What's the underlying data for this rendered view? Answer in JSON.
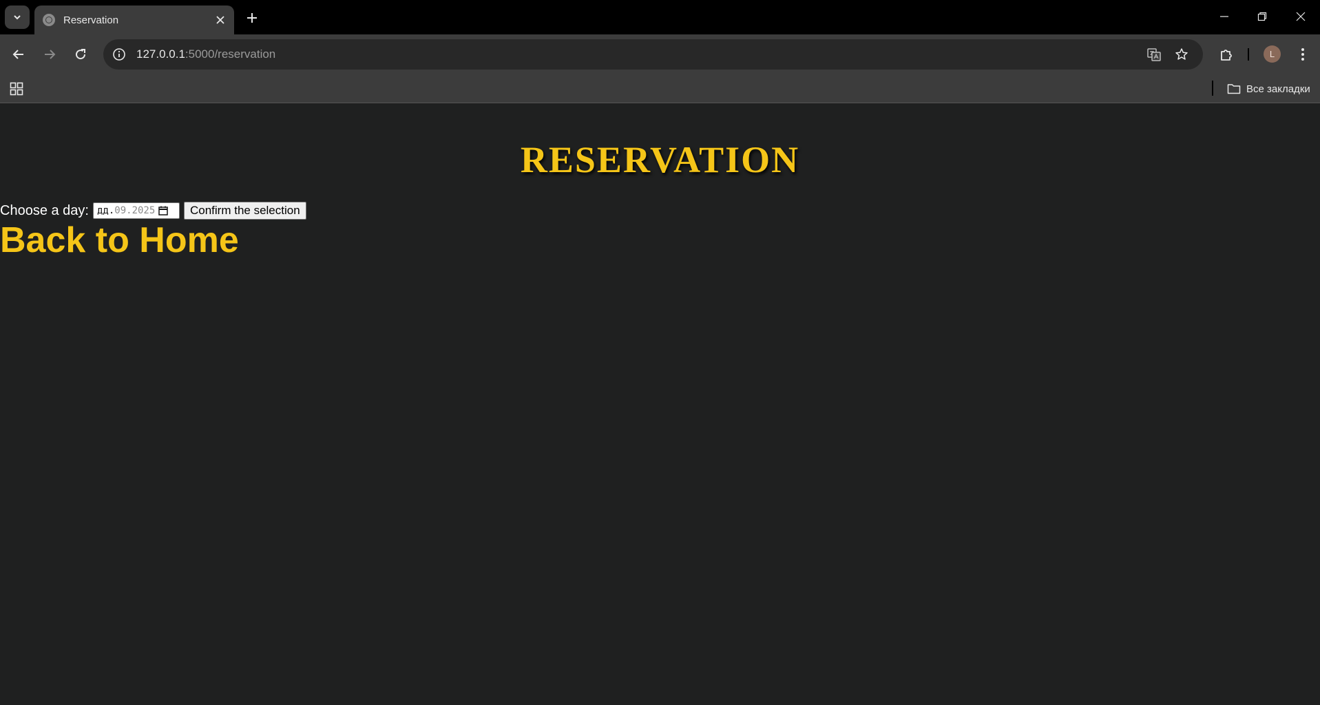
{
  "browser": {
    "tab": {
      "title": "Reservation"
    },
    "address_bar": {
      "host": "127.0.0.1",
      "rest": ":5000/reservation"
    },
    "profile_initial": "L",
    "bookmarks_bar": {
      "all_bookmarks_label": "Все закладки"
    }
  },
  "page": {
    "title": "RESERVATION",
    "form": {
      "label": "Choose a day:",
      "date_day_placeholder": "дд.",
      "date_rest": "09.2025",
      "confirm_label": "Confirm the selection"
    },
    "home_link": "Back to Home"
  },
  "colors": {
    "accent": "#f5c518",
    "page_background": "#1f2020",
    "chrome_background": "#3c3c3c"
  }
}
